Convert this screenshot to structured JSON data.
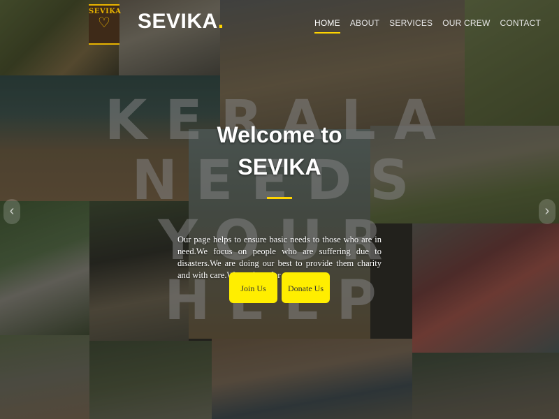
{
  "header": {
    "logo_text": "SEVIKA",
    "brand_name": "SEVIKA",
    "brand_dot": ".",
    "accent_color": "#ffd400"
  },
  "nav": {
    "items": [
      {
        "label": "HOME",
        "active": true
      },
      {
        "label": "ABOUT",
        "active": false
      },
      {
        "label": "SERVICES",
        "active": false
      },
      {
        "label": "OUR CREW",
        "active": false
      },
      {
        "label": "CONTACT",
        "active": false
      }
    ]
  },
  "banner": {
    "lines": [
      "KERALA",
      "NEEDS",
      "YOUR",
      "HELP"
    ]
  },
  "hero": {
    "welcome_line1": "Welcome to",
    "welcome_line2": "SEVIKA",
    "description": "Our page helps to ensure basic needs to those who are in need.We focus on people who are suffering due to disasters.We are doing our best to provide them charity and with care.We are here for you.",
    "join_label": "Join Us",
    "donate_label": "Donate Us",
    "button_color": "#ffee00"
  },
  "carousel": {
    "prev_icon": "chevron-left-icon",
    "next_icon": "chevron-right-icon"
  }
}
